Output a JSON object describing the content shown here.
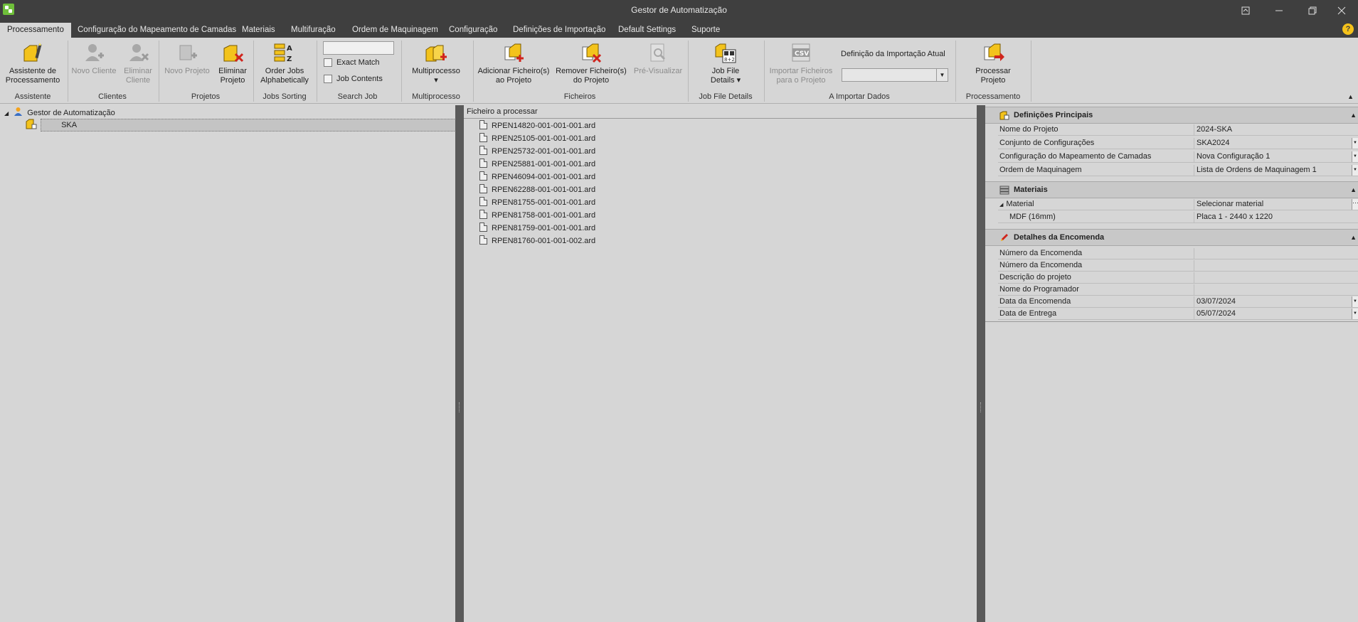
{
  "window": {
    "title": "Gestor de Automatização"
  },
  "ribbon_tabs": [
    {
      "label": "Processamento",
      "active": true
    },
    {
      "label": "Configuração do Mapeamento de Camadas"
    },
    {
      "label": "Materiais"
    },
    {
      "label": "Multifuração"
    },
    {
      "label": "Ordem de Maquinagem"
    },
    {
      "label": "Configuração"
    },
    {
      "label": "Definições de Importação"
    },
    {
      "label": "Default Settings"
    },
    {
      "label": "Suporte"
    }
  ],
  "help_glyph": "?",
  "ribbon": {
    "assistente": {
      "line1": "Assistente de",
      "line2": "Processamento",
      "group": "Assistente"
    },
    "novo_cliente": {
      "line1": "Novo Cliente",
      "line2": ""
    },
    "eliminar_cliente": {
      "line1": "Eliminar",
      "line2": "Cliente"
    },
    "clientes_group": "Clientes",
    "novo_projeto": {
      "line1": "Novo Projeto",
      "line2": ""
    },
    "eliminar_projeto": {
      "line1": "Eliminar",
      "line2": "Projeto"
    },
    "projetos_group": "Projetos",
    "order_jobs": {
      "line1": "Order Jobs",
      "line2": "Alphabetically",
      "group": "Jobs Sorting"
    },
    "search": {
      "value": "",
      "exact_match": "Exact Match",
      "job_contents": "Job Contents",
      "group": "Search Job"
    },
    "multiprocesso": {
      "line1": "Multiprocesso",
      "line2": "▾",
      "group": "Multiprocesso"
    },
    "adicionar_ficheiros": {
      "line1": "Adicionar Ficheiro(s)",
      "line2": "ao Projeto"
    },
    "remover_ficheiros": {
      "line1": "Remover Ficheiro(s)",
      "line2": "do Projeto"
    },
    "pre_visualizar": {
      "line1": "Pré-Visualizar",
      "line2": ""
    },
    "ficheiros_group": "Ficheiros",
    "job_file_details": {
      "line1": "Job File",
      "line2": "Details ▾",
      "group": "Job File Details"
    },
    "importar_ficheiros": {
      "line1": "Importar Ficheiros",
      "line2": "para o Projeto"
    },
    "definicao_label": "Definição da Importação Atual",
    "definicao_value": "",
    "importar_group": "A Importar Dados",
    "processar_projeto": {
      "line1": "Processar",
      "line2": "Projeto",
      "group": "Processamento"
    }
  },
  "tree": {
    "root": "Gestor de Automatização",
    "child": "SKA"
  },
  "files": {
    "header": "Ficheiro a processar",
    "items": [
      "RPEN14820-001-001-001.ard",
      "RPEN25105-001-001-001.ard",
      "RPEN25732-001-001-001.ard",
      "RPEN25881-001-001-001.ard",
      "RPEN46094-001-001-001.ard",
      "RPEN62288-001-001-001.ard",
      "RPEN81755-001-001-001.ard",
      "RPEN81758-001-001-001.ard",
      "RPEN81759-001-001-001.ard",
      "RPEN81760-001-001-002.ard"
    ]
  },
  "properties": {
    "principais": {
      "title": "Definições Principais",
      "rows": [
        {
          "name": "Nome do Projeto",
          "value": "2024-SKA"
        },
        {
          "name": "Conjunto de Configurações",
          "value": "SKA2024"
        },
        {
          "name": "Configuração do Mapeamento de Camadas",
          "value": "Nova Configuração 1"
        },
        {
          "name": "Ordem de Maquinagem",
          "value": "Lista de Ordens de Maquinagem 1"
        }
      ]
    },
    "materiais": {
      "title": "Materiais",
      "material_name": "Material",
      "material_value": "Selecionar material",
      "sub_name": "MDF (16mm)",
      "sub_value": "Placa 1 - 2440 x 1220"
    },
    "encomenda": {
      "title": "Detalhes da Encomenda",
      "rows": [
        {
          "name": "Número da Encomenda",
          "value": ""
        },
        {
          "name": "Número da Encomenda",
          "value": ""
        },
        {
          "name": "Descrição do projeto",
          "value": ""
        },
        {
          "name": "Nome do Programador",
          "value": ""
        },
        {
          "name": "Data da Encomenda",
          "value": "03/07/2024"
        },
        {
          "name": "Data de Entrega",
          "value": "05/07/2024"
        }
      ]
    }
  }
}
